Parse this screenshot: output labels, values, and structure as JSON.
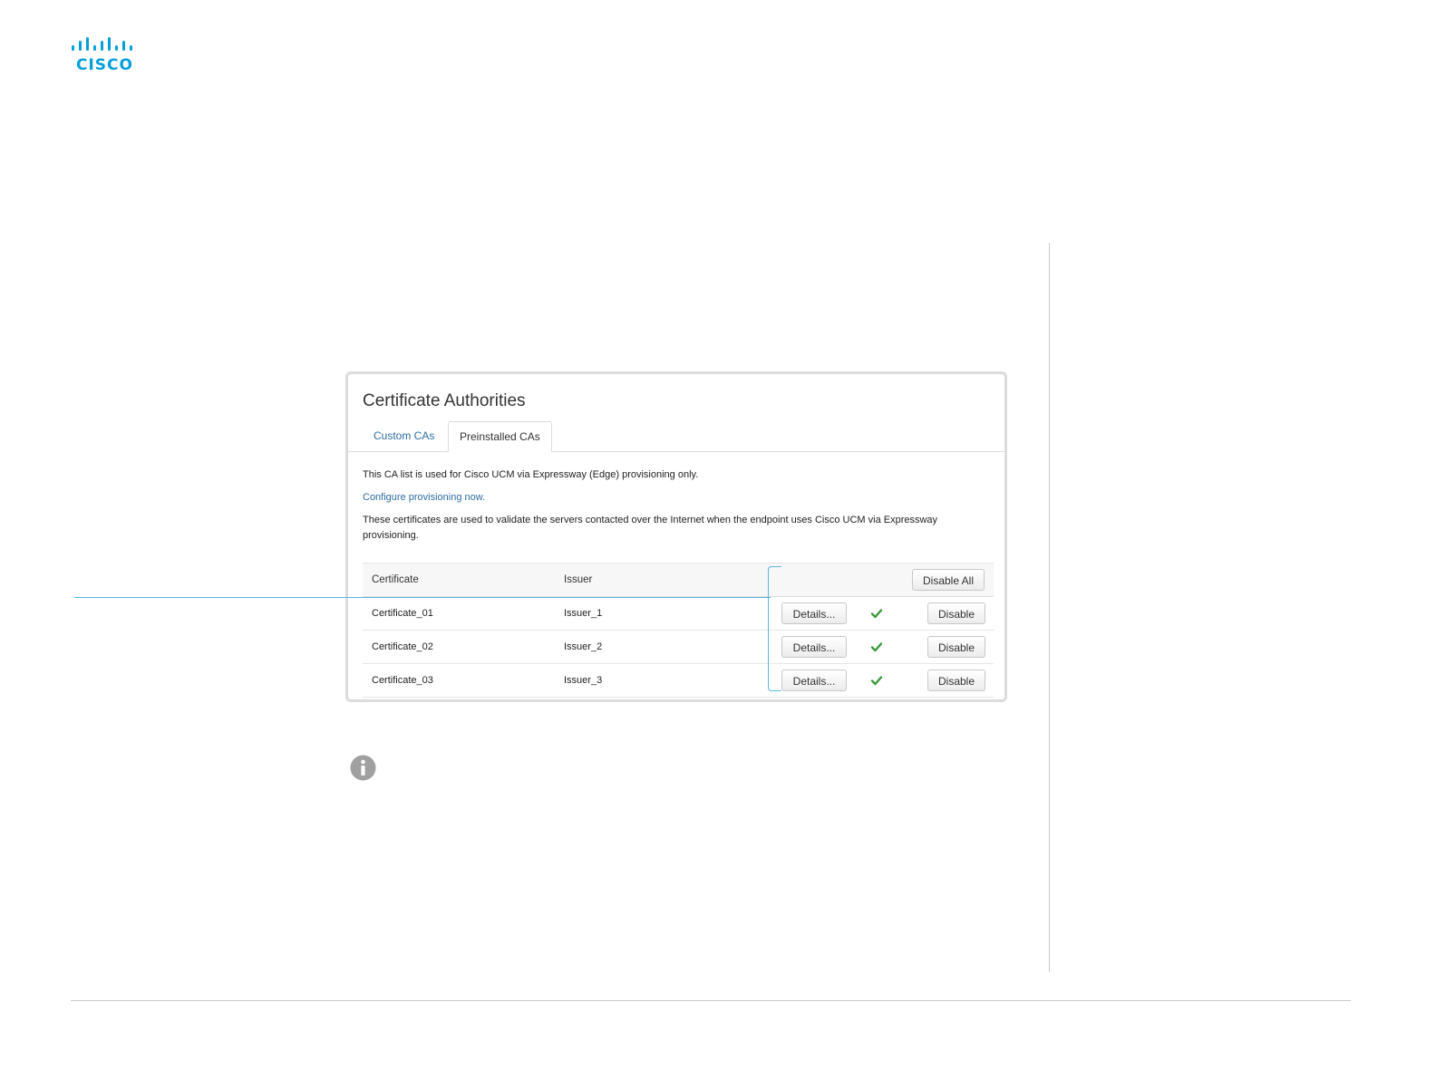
{
  "brand": {
    "logo_text": "CISCO",
    "color": "#049fd9"
  },
  "screenshot": {
    "title": "Certificate Authorities",
    "tabs": [
      {
        "label": "Custom CAs",
        "active": false
      },
      {
        "label": "Preinstalled CAs",
        "active": true
      }
    ],
    "text1": "This CA list is used for Cisco UCM via Expressway (Edge) provisioning only.",
    "link": "Configure provisioning now.",
    "text2": "These certificates are used to validate the servers contacted over the Internet when the endpoint uses Cisco UCM via Expressway provisioning.",
    "table": {
      "headers": {
        "certificate": "Certificate",
        "issuer": "Issuer"
      },
      "disable_all_label": "Disable All",
      "details_label": "Details...",
      "disable_label": "Disable",
      "rows": [
        {
          "certificate": "Certificate_01",
          "issuer": "Issuer_1",
          "enabled": true
        },
        {
          "certificate": "Certificate_02",
          "issuer": "Issuer_2",
          "enabled": true
        },
        {
          "certificate": "Certificate_03",
          "issuer": "Issuer_3",
          "enabled": true
        }
      ]
    }
  },
  "colors": {
    "callout": "#5bb7dd",
    "link": "#2e6da4",
    "check": "#3a9a3a",
    "info_icon": "#a0a0a0"
  },
  "icons": {
    "check": "check-icon",
    "info": "info-icon"
  }
}
